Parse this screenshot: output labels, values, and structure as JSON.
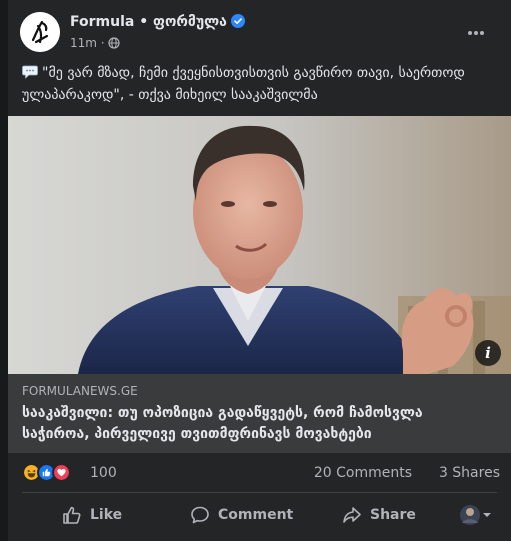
{
  "post": {
    "page_name": "Formula • ფორმულა",
    "time": "11m ·",
    "emoji_icon": "speech-bubble",
    "text": "\"მე ვარ მზად, ჩემი ქვეყნისთვისთვის გავწირო თავი, საერთოდ ულაპარაკოდ\", - თქვა მიხეილ სააკაშვილმა"
  },
  "link": {
    "domain": "FORMULANEWS.GE",
    "headline": "სააკაშვილი: თუ ოპოზიცია გადაწყვეტს, რომ ჩამოსვლა საჭიროა, პირველივე თვითმფრინავს მოვახტები"
  },
  "stats": {
    "reaction_count": "100",
    "comments": "20 Comments",
    "shares": "3 Shares"
  },
  "actions": {
    "like": "Like",
    "comment": "Comment",
    "share": "Share"
  },
  "colors": {
    "card_bg": "#242526",
    "preview_bg": "#3a3b3c",
    "text_primary": "#e4e6eb",
    "text_secondary": "#b0b3b8",
    "verified_blue": "#2d88ff",
    "like_blue": "#1877f2",
    "love_red": "#f33e58",
    "haha_yellow": "#f7b125"
  }
}
